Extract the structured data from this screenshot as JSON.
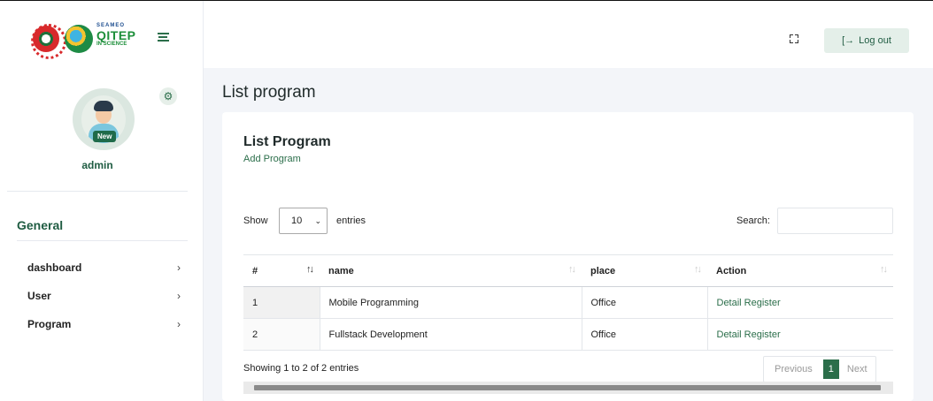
{
  "brand": {
    "logo_text_line1": "SEAMEO",
    "logo_text_line2": "QITEP",
    "logo_text_line3": "IN SCIENCE"
  },
  "header": {
    "logout_label": "Log out",
    "logout_icon": "logout-icon",
    "fullscreen_icon": "fullscreen-icon"
  },
  "profile": {
    "badge": "New",
    "name": "admin"
  },
  "sidebar": {
    "heading": "General",
    "items": [
      {
        "label": "dashboard",
        "chevron": "›"
      },
      {
        "label": "User",
        "chevron": "›"
      },
      {
        "label": "Program",
        "chevron": "›"
      }
    ]
  },
  "page": {
    "title": "List program"
  },
  "card": {
    "title": "List Program",
    "add_link": "Add Program"
  },
  "datatable": {
    "show_label": "Show",
    "length_value": "10",
    "entries_label": "entries",
    "search_label": "Search:",
    "search_value": "",
    "columns": [
      "#",
      "name",
      "place",
      "Action"
    ],
    "rows": [
      {
        "no": "1",
        "name": "Mobile Programming",
        "place": "Office",
        "action": "Detail Register"
      },
      {
        "no": "2",
        "name": "Fullstack Development",
        "place": "Office",
        "action": "Detail Register"
      }
    ],
    "info": "Showing 1 to 2 of 2 entries",
    "pagination": {
      "previous": "Previous",
      "current": "1",
      "next": "Next"
    }
  },
  "colors": {
    "accent": "#2b6e4a",
    "accent_light": "#e4efe9",
    "background": "#f3f5f9"
  }
}
